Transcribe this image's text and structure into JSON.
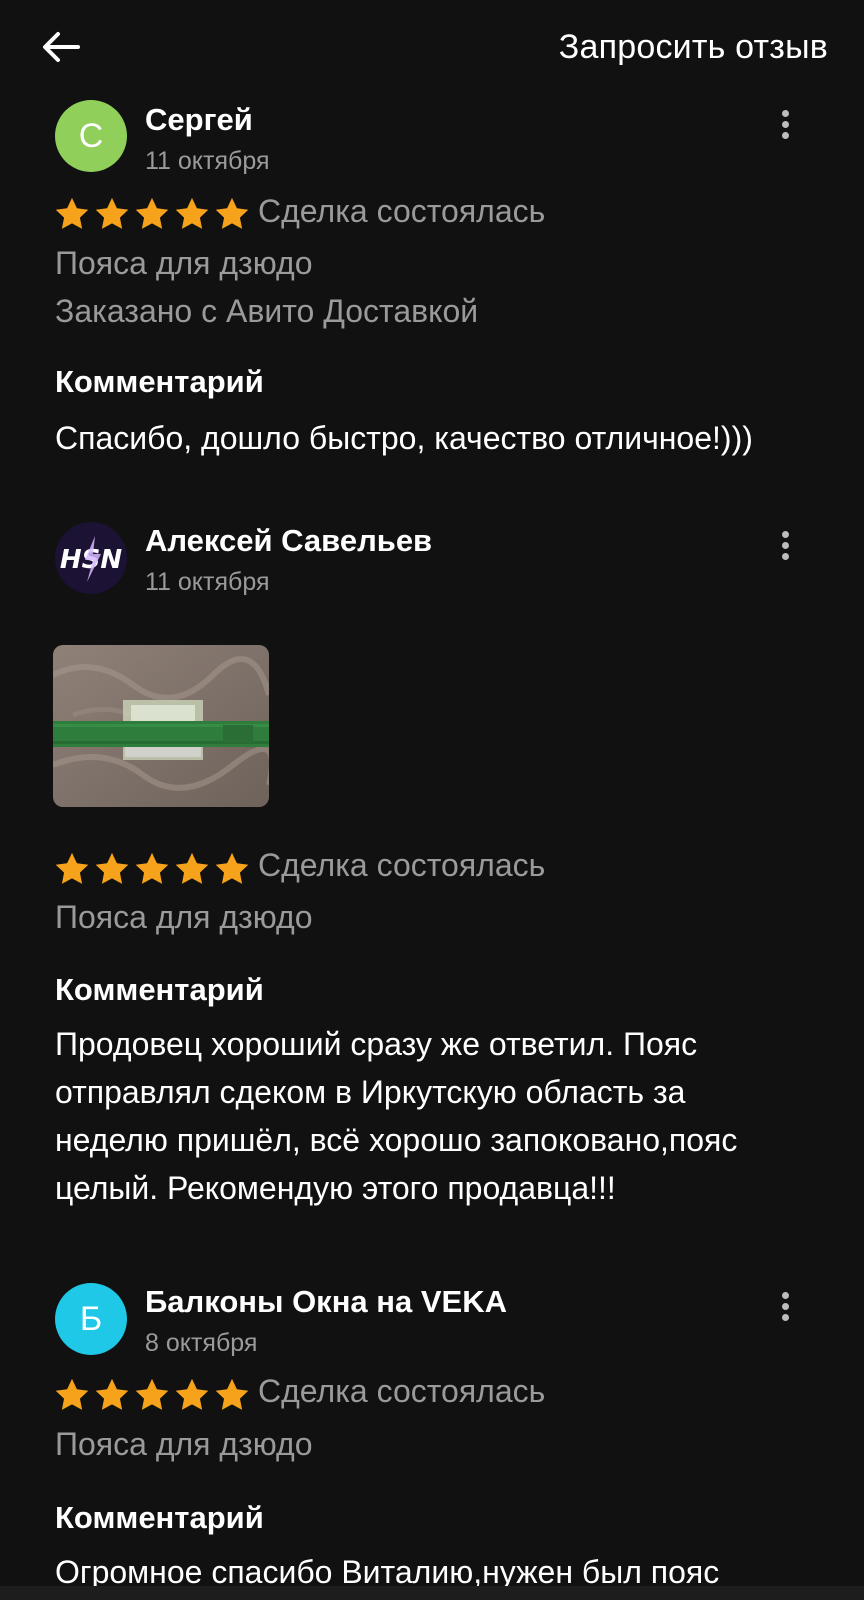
{
  "header": {
    "back_icon": "arrow-left-icon",
    "request_review_label": "Запросить отзыв"
  },
  "colors": {
    "background": "#111111",
    "star": "#f7a21b",
    "muted_text": "#9a9a9a",
    "avatar_green": "#8fcf5a",
    "avatar_cyan": "#1ec8e6"
  },
  "reviews": [
    {
      "avatar_letter": "С",
      "name": "Сергей",
      "date": "11 октября",
      "rating": 5,
      "deal_status": "Сделка состоялась",
      "item": "Пояса для дзюдо",
      "delivery": "Заказано с Авито Доставкой",
      "comment_label": "Комментарий",
      "comment": "Спасибо, дошло быстро, качество отличное!)))"
    },
    {
      "avatar_icon": "user-logo-icon",
      "avatar_text": "HSN",
      "name": "Алексей Савельев",
      "date": "11 октября",
      "photo": "green-belt-photo",
      "rating": 5,
      "deal_status": "Сделка состоялась",
      "item": "Пояса для дзюдо",
      "comment_label": "Комментарий",
      "comment_lines": [
        "Продовец хороший сразу же ответил. Пояс",
        "отправлял сдеком в Иркутскую область за",
        "неделю пришёл, всё хорошо запоковано,пояс",
        "целый. Рекомендую этого продавца!!!"
      ]
    },
    {
      "avatar_letter": "Б",
      "name": "Балконы Окна на VEKA",
      "date": "8 октября",
      "rating": 5,
      "deal_status": "Сделка состоялась",
      "item": "Пояса для дзюдо",
      "comment_label": "Комментарий",
      "comment": "Огромное спасибо Виталию,нужен был пояс"
    }
  ]
}
